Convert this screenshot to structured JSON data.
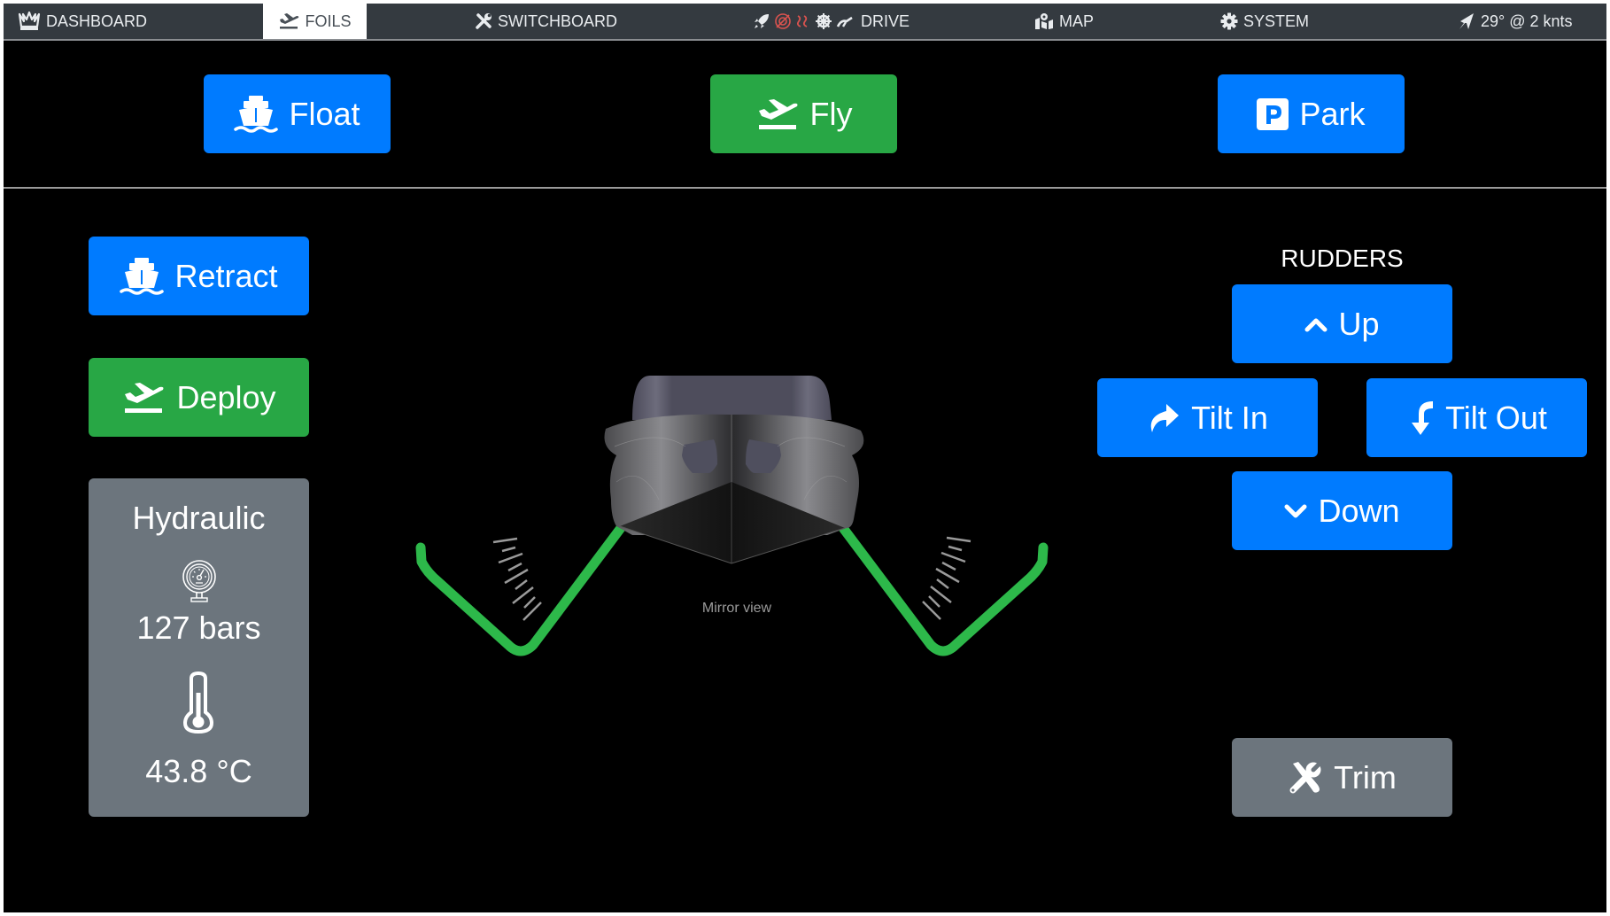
{
  "navbar": {
    "items": [
      {
        "label": "DASHBOARD",
        "icon": "crown-icon"
      },
      {
        "label": "FOILS",
        "icon": "plane-departure-icon",
        "active": true
      },
      {
        "label": "SWITCHBOARD",
        "icon": "tools-icon"
      },
      {
        "label": "DRIVE",
        "icon": "drive-status-icons"
      },
      {
        "label": "MAP",
        "icon": "map-marked-icon"
      },
      {
        "label": "SYSTEM",
        "icon": "gear-icon"
      }
    ],
    "wind": {
      "label": "29° @ 2 knts",
      "icon": "location-arrow-icon"
    }
  },
  "modes": {
    "float": {
      "label": "Float",
      "icon": "ship-icon"
    },
    "fly": {
      "label": "Fly",
      "icon": "plane-departure-icon"
    },
    "park": {
      "label": "Park",
      "icon": "parking-icon"
    }
  },
  "foils": {
    "retract": {
      "label": "Retract",
      "icon": "ship-icon"
    },
    "deploy": {
      "label": "Deploy",
      "icon": "plane-departure-icon"
    }
  },
  "hydraulic": {
    "title": "Hydraulic",
    "pressure": "127 bars",
    "temperature": "43.8 °C"
  },
  "boat_view": {
    "caption": "Mirror view",
    "foil_state": "deployed"
  },
  "rudders": {
    "title": "RUDDERS",
    "up": {
      "label": "Up",
      "icon": "chevron-up-icon"
    },
    "tilt_in": {
      "label": "Tilt In",
      "icon": "share-arrow-icon"
    },
    "tilt_out": {
      "label": "Tilt Out",
      "icon": "level-down-arrow-icon"
    },
    "down": {
      "label": "Down",
      "icon": "chevron-down-icon"
    }
  },
  "trim": {
    "label": "Trim",
    "icon": "tools-icon"
  },
  "colors": {
    "primary": "#007bff",
    "success": "#28a745",
    "secondary": "#6c757d",
    "navbar": "#343a40",
    "foil": "#2db84a",
    "alert": "#d9534f"
  }
}
